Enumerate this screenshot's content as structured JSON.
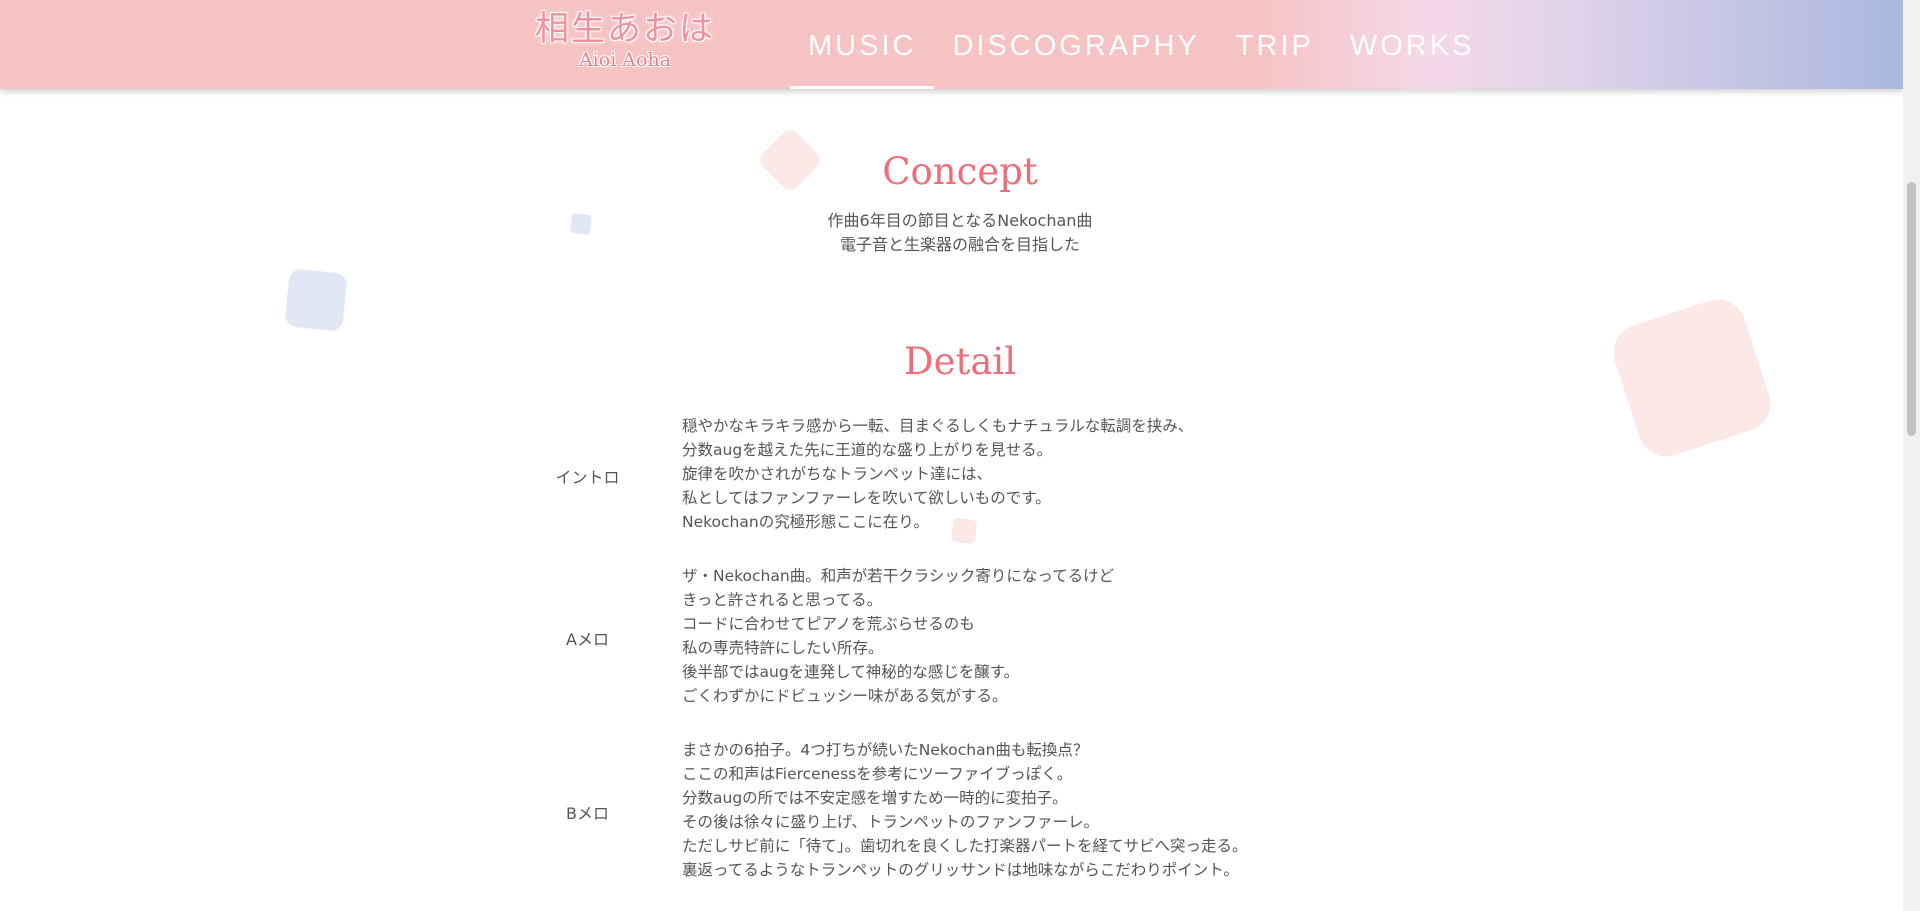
{
  "header": {
    "logo_jp": "相生あおは",
    "logo_en": "Aioi Aoha",
    "nav": [
      "MUSIC",
      "DISCOGRAPHY",
      "TRIP",
      "WORKS"
    ],
    "active_nav": "MUSIC"
  },
  "concept": {
    "title": "Concept",
    "lines": [
      "作曲6年目の節目となるNekochan曲",
      "電子音と生楽器の融合を目指した"
    ]
  },
  "detail": {
    "title": "Detail",
    "rows": [
      {
        "label": "イントロ",
        "lines": [
          "穏やかなキラキラ感から一転、目まぐるしくもナチュラルな転調を挟み、",
          "分数augを越えた先に王道的な盛り上がりを見せる。",
          "旋律を吹かされがちなトランペット達には、",
          "私としてはファンファーレを吹いて欲しいものです。",
          "Nekochanの究極形態ここに在り。"
        ]
      },
      {
        "label": "Aメロ",
        "lines": [
          "ザ・Nekochan曲。和声が若干クラシック寄りになってるけど",
          "きっと許されると思ってる。",
          "コードに合わせてピアノを荒ぶらせるのも",
          "私の専売特許にしたい所存。",
          "後半部ではaugを連発して神秘的な感じを醸す。",
          "ごくわずかにドビュッシー味がある気がする。"
        ]
      },
      {
        "label": "Bメロ",
        "lines": [
          "まさかの6拍子。4つ打ちが続いたNekochan曲も転換点？",
          "ここの和声はFiercenessを参考にツーファイブっぽく。",
          "分数augの所では不安定感を増すため一時的に変拍子。",
          "その後は徐々に盛り上げ、トランペットのファンファーレ。",
          "ただしサビ前に「待て」。歯切れを良くした打楽器パートを経てサビへ突っ走る。",
          "裏返ってるようなトランペットのグリッサンドは地味ながらこだわりポイント。"
        ]
      }
    ]
  },
  "colors": {
    "accent": "#ec6e7a",
    "header_pink": "#f6c3c5",
    "header_blue": "#a9b8e0",
    "deco_pink": "#fde8e8",
    "deco_blue": "#e2e7f4"
  }
}
